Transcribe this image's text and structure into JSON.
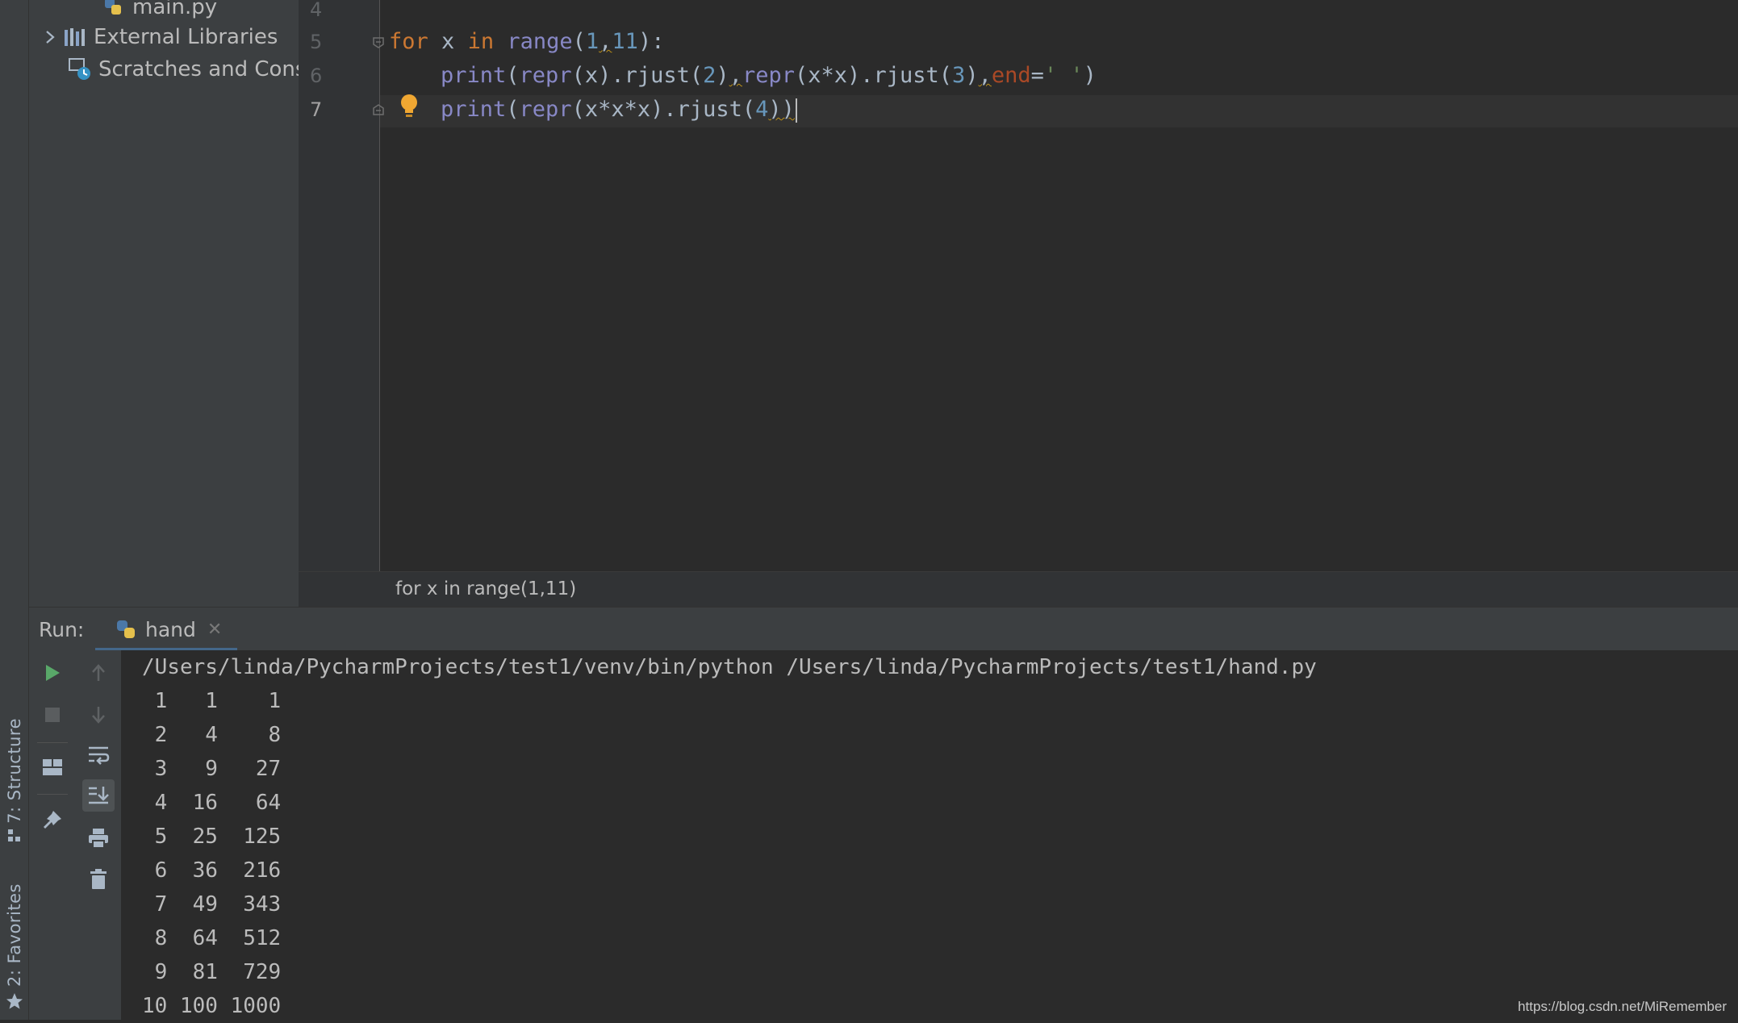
{
  "colors": {
    "background": "#2b2b2b",
    "panel": "#3c3f41",
    "keyword": "#cc7832",
    "builtin": "#8888c6",
    "number": "#6897bb",
    "string": "#6a8759",
    "param": "#aa4926",
    "run_green": "#59a869"
  },
  "sidebar": {
    "structure_tab": "7: Structure",
    "favorites_tab": "2: Favorites"
  },
  "project_tree": {
    "items": [
      {
        "label": "main.py",
        "icon": "python-file-icon"
      },
      {
        "label": "External Libraries",
        "icon": "libraries-icon"
      },
      {
        "label": "Scratches and Cons",
        "icon": "scratches-icon"
      }
    ]
  },
  "editor": {
    "line_numbers": [
      "4",
      "5",
      "6",
      "7"
    ],
    "lines": [
      {
        "number": "5",
        "tokens": [
          "for",
          " x ",
          "in",
          " ",
          "range",
          "(",
          "1",
          ",",
          "11",
          "):"
        ]
      },
      {
        "number": "6",
        "tokens": [
          "print",
          "(",
          "repr",
          "(x).rjust(",
          "2",
          ")",
          ",",
          "repr",
          "(x*x).rjust(",
          "3",
          ")",
          ",",
          "end",
          "=",
          "' '",
          ")"
        ]
      },
      {
        "number": "7",
        "tokens": [
          "print",
          "(",
          "repr",
          "(x*x*x).rjust(",
          "4",
          "))"
        ]
      }
    ]
  },
  "breadcrumb": "for x in range(1,11)",
  "run": {
    "label": "Run:",
    "tab_name": "hand",
    "command": "/Users/linda/PycharmProjects/test1/venv/bin/python /Users/linda/PycharmProjects/test1/hand.py",
    "output": [
      " 1   1    1",
      " 2   4    8",
      " 3   9   27",
      " 4  16   64",
      " 5  25  125",
      " 6  36  216",
      " 7  49  343",
      " 8  64  512",
      " 9  81  729",
      "10 100 1000"
    ]
  },
  "watermark": "https://blog.csdn.net/MiRemember"
}
